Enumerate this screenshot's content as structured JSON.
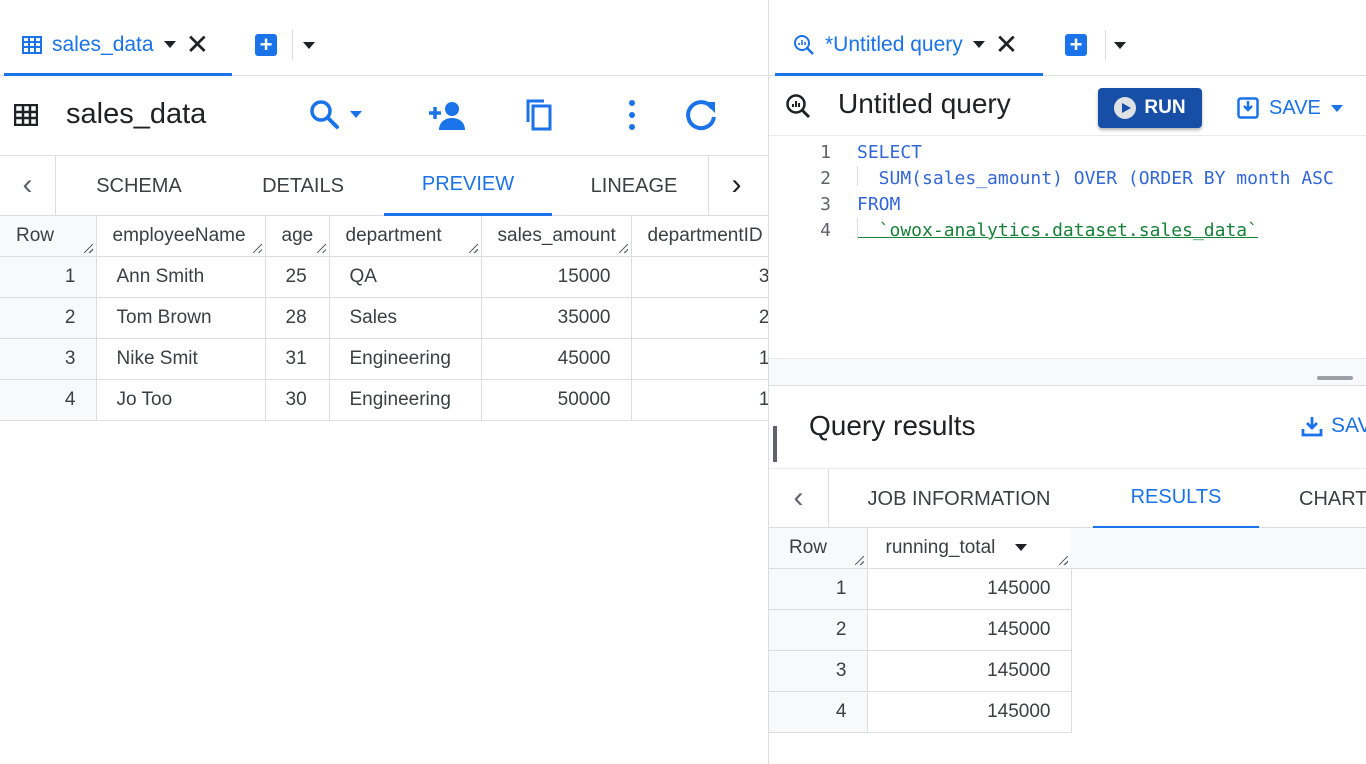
{
  "left": {
    "tab": {
      "title": "sales_data",
      "close": "✕"
    },
    "toolbar": {
      "title": "sales_data"
    },
    "subtabs": [
      "SCHEMA",
      "DETAILS",
      "PREVIEW",
      "LINEAGE"
    ],
    "active_subtab": "PREVIEW",
    "table": {
      "headers": [
        "Row",
        "employeeName",
        "age",
        "department",
        "sales_amount",
        "departmentID"
      ],
      "rows": [
        [
          "1",
          "Ann Smith",
          "25",
          "QA",
          "15000",
          "3"
        ],
        [
          "2",
          "Tom Brown",
          "28",
          "Sales",
          "35000",
          "2"
        ],
        [
          "3",
          "Nike Smit",
          "31",
          "Engineering",
          "45000",
          "1"
        ],
        [
          "4",
          "Jo Too",
          "30",
          "Engineering",
          "50000",
          "1"
        ]
      ]
    }
  },
  "right": {
    "tab": {
      "title": "*Untitled query",
      "close": "✕"
    },
    "toolbar": {
      "title": "Untitled query",
      "run_label": "RUN",
      "save_label": "SAVE"
    },
    "editor": {
      "line_numbers": [
        "1",
        "2",
        "3",
        "4"
      ],
      "lines": [
        "SELECT",
        "  SUM(sales_amount) OVER (ORDER BY month ASC",
        "FROM",
        "  `owox-analytics.dataset.sales_data`"
      ]
    },
    "results": {
      "title": "Query results",
      "save_label": "SAV",
      "tabs": [
        "JOB INFORMATION",
        "RESULTS",
        "CHART"
      ],
      "active_tab": "RESULTS",
      "headers": [
        "Row",
        "running_total"
      ],
      "rows": [
        [
          "1",
          "145000"
        ],
        [
          "2",
          "145000"
        ],
        [
          "3",
          "145000"
        ],
        [
          "4",
          "145000"
        ]
      ]
    }
  }
}
